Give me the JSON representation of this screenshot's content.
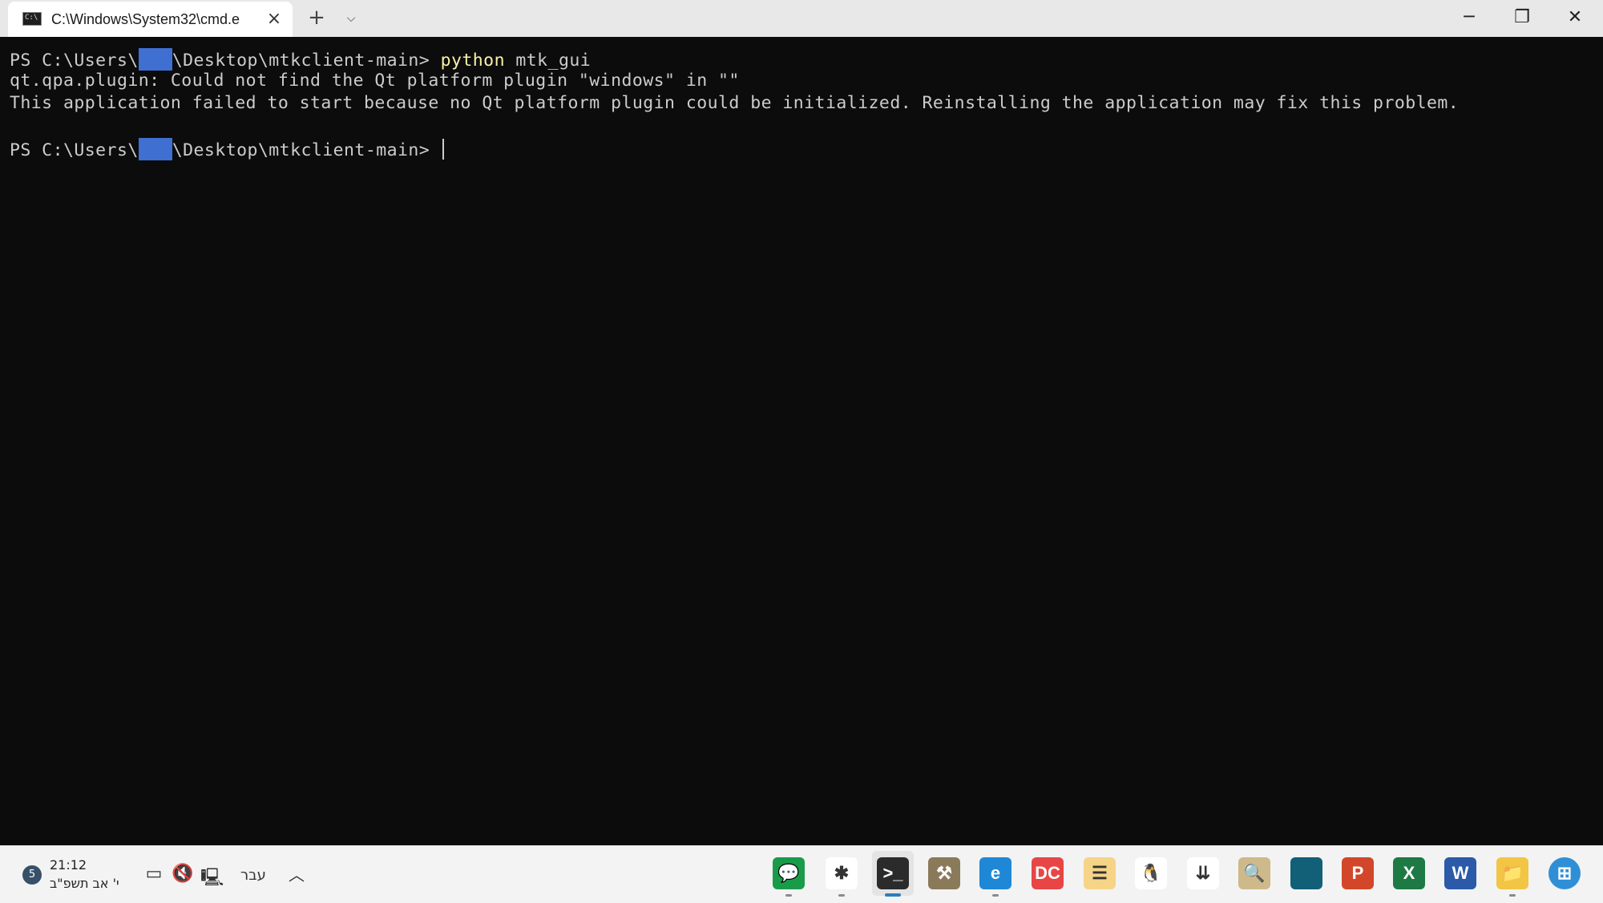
{
  "window": {
    "tab_title": "C:\\Windows\\System32\\cmd.e",
    "tab_close_icon": "×",
    "new_tab_icon": "+",
    "dropdown_icon": "⌵",
    "min_icon": "─",
    "max_icon": "❐",
    "close_icon": "✕"
  },
  "terminal": {
    "lines": [
      {
        "prompt_a": "PS C:\\Users\\",
        "prompt_b": "\\Desktop\\mtkclient-main> ",
        "command": "python",
        "args": " mtk_gui"
      },
      {
        "text": "qt.qpa.plugin: Could not find the Qt platform plugin \"windows\" in \"\""
      },
      {
        "text": "This application failed to start because no Qt platform plugin could be initialized. Reinstalling the application may fix this problem."
      },
      {
        "prompt_a": "PS C:\\Users\\",
        "prompt_b": "\\Desktop\\mtkclient-main> "
      }
    ],
    "colors": {
      "background": "#0c0c0c",
      "text": "#cccccc",
      "command": "#f9f1a5",
      "redaction": "#3f6fd0"
    }
  },
  "taskbar": {
    "notification_count": "5",
    "time": "21:12",
    "date": "י' אב תשפ\"ב",
    "language": "עבר",
    "icons": [
      {
        "name": "chat-app-icon",
        "glyph": "💬",
        "bg": "#1a9b4a"
      },
      {
        "name": "slack-icon",
        "glyph": "✱",
        "bg": "#ffffff"
      },
      {
        "name": "terminal-icon",
        "glyph": ">_",
        "bg": "#2b2b2b"
      },
      {
        "name": "tools-icon",
        "glyph": "⚒",
        "bg": "#8a7a5a"
      },
      {
        "name": "edge-icon",
        "glyph": "e",
        "bg": "#1f88d6"
      },
      {
        "name": "dc-app-icon",
        "glyph": "DC",
        "bg": "#e84545"
      },
      {
        "name": "notes-icon",
        "glyph": "☰",
        "bg": "#f6d487"
      },
      {
        "name": "linux-icon",
        "glyph": "🐧",
        "bg": "#ffffff"
      },
      {
        "name": "app-blue-icon",
        "glyph": "⇊",
        "bg": "#ffffff"
      },
      {
        "name": "search-app-icon",
        "glyph": "🔍",
        "bg": "#cdb98a"
      },
      {
        "name": "teal-app-icon",
        "glyph": "",
        "bg": "#125f78"
      },
      {
        "name": "powerpoint-icon",
        "glyph": "P",
        "bg": "#d2472a"
      },
      {
        "name": "excel-icon",
        "glyph": "X",
        "bg": "#1d7a44"
      },
      {
        "name": "word-icon",
        "glyph": "W",
        "bg": "#2a5aa8"
      },
      {
        "name": "file-explorer-icon",
        "glyph": "📁",
        "bg": "#f3c545"
      },
      {
        "name": "start-icon",
        "glyph": "⊞",
        "bg": "#2f8fd6"
      }
    ]
  }
}
